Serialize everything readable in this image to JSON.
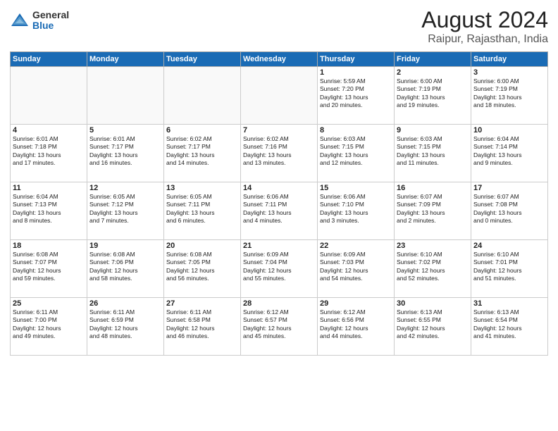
{
  "header": {
    "logo_general": "General",
    "logo_blue": "Blue",
    "month_year": "August 2024",
    "location": "Raipur, Rajasthan, India"
  },
  "columns": [
    "Sunday",
    "Monday",
    "Tuesday",
    "Wednesday",
    "Thursday",
    "Friday",
    "Saturday"
  ],
  "weeks": [
    [
      {
        "day": "",
        "info": ""
      },
      {
        "day": "",
        "info": ""
      },
      {
        "day": "",
        "info": ""
      },
      {
        "day": "",
        "info": ""
      },
      {
        "day": "1",
        "info": "Sunrise: 5:59 AM\nSunset: 7:20 PM\nDaylight: 13 hours\nand 20 minutes."
      },
      {
        "day": "2",
        "info": "Sunrise: 6:00 AM\nSunset: 7:19 PM\nDaylight: 13 hours\nand 19 minutes."
      },
      {
        "day": "3",
        "info": "Sunrise: 6:00 AM\nSunset: 7:19 PM\nDaylight: 13 hours\nand 18 minutes."
      }
    ],
    [
      {
        "day": "4",
        "info": "Sunrise: 6:01 AM\nSunset: 7:18 PM\nDaylight: 13 hours\nand 17 minutes."
      },
      {
        "day": "5",
        "info": "Sunrise: 6:01 AM\nSunset: 7:17 PM\nDaylight: 13 hours\nand 16 minutes."
      },
      {
        "day": "6",
        "info": "Sunrise: 6:02 AM\nSunset: 7:17 PM\nDaylight: 13 hours\nand 14 minutes."
      },
      {
        "day": "7",
        "info": "Sunrise: 6:02 AM\nSunset: 7:16 PM\nDaylight: 13 hours\nand 13 minutes."
      },
      {
        "day": "8",
        "info": "Sunrise: 6:03 AM\nSunset: 7:15 PM\nDaylight: 13 hours\nand 12 minutes."
      },
      {
        "day": "9",
        "info": "Sunrise: 6:03 AM\nSunset: 7:15 PM\nDaylight: 13 hours\nand 11 minutes."
      },
      {
        "day": "10",
        "info": "Sunrise: 6:04 AM\nSunset: 7:14 PM\nDaylight: 13 hours\nand 9 minutes."
      }
    ],
    [
      {
        "day": "11",
        "info": "Sunrise: 6:04 AM\nSunset: 7:13 PM\nDaylight: 13 hours\nand 8 minutes."
      },
      {
        "day": "12",
        "info": "Sunrise: 6:05 AM\nSunset: 7:12 PM\nDaylight: 13 hours\nand 7 minutes."
      },
      {
        "day": "13",
        "info": "Sunrise: 6:05 AM\nSunset: 7:11 PM\nDaylight: 13 hours\nand 6 minutes."
      },
      {
        "day": "14",
        "info": "Sunrise: 6:06 AM\nSunset: 7:11 PM\nDaylight: 13 hours\nand 4 minutes."
      },
      {
        "day": "15",
        "info": "Sunrise: 6:06 AM\nSunset: 7:10 PM\nDaylight: 13 hours\nand 3 minutes."
      },
      {
        "day": "16",
        "info": "Sunrise: 6:07 AM\nSunset: 7:09 PM\nDaylight: 13 hours\nand 2 minutes."
      },
      {
        "day": "17",
        "info": "Sunrise: 6:07 AM\nSunset: 7:08 PM\nDaylight: 13 hours\nand 0 minutes."
      }
    ],
    [
      {
        "day": "18",
        "info": "Sunrise: 6:08 AM\nSunset: 7:07 PM\nDaylight: 12 hours\nand 59 minutes."
      },
      {
        "day": "19",
        "info": "Sunrise: 6:08 AM\nSunset: 7:06 PM\nDaylight: 12 hours\nand 58 minutes."
      },
      {
        "day": "20",
        "info": "Sunrise: 6:08 AM\nSunset: 7:05 PM\nDaylight: 12 hours\nand 56 minutes."
      },
      {
        "day": "21",
        "info": "Sunrise: 6:09 AM\nSunset: 7:04 PM\nDaylight: 12 hours\nand 55 minutes."
      },
      {
        "day": "22",
        "info": "Sunrise: 6:09 AM\nSunset: 7:03 PM\nDaylight: 12 hours\nand 54 minutes."
      },
      {
        "day": "23",
        "info": "Sunrise: 6:10 AM\nSunset: 7:02 PM\nDaylight: 12 hours\nand 52 minutes."
      },
      {
        "day": "24",
        "info": "Sunrise: 6:10 AM\nSunset: 7:01 PM\nDaylight: 12 hours\nand 51 minutes."
      }
    ],
    [
      {
        "day": "25",
        "info": "Sunrise: 6:11 AM\nSunset: 7:00 PM\nDaylight: 12 hours\nand 49 minutes."
      },
      {
        "day": "26",
        "info": "Sunrise: 6:11 AM\nSunset: 6:59 PM\nDaylight: 12 hours\nand 48 minutes."
      },
      {
        "day": "27",
        "info": "Sunrise: 6:11 AM\nSunset: 6:58 PM\nDaylight: 12 hours\nand 46 minutes."
      },
      {
        "day": "28",
        "info": "Sunrise: 6:12 AM\nSunset: 6:57 PM\nDaylight: 12 hours\nand 45 minutes."
      },
      {
        "day": "29",
        "info": "Sunrise: 6:12 AM\nSunset: 6:56 PM\nDaylight: 12 hours\nand 44 minutes."
      },
      {
        "day": "30",
        "info": "Sunrise: 6:13 AM\nSunset: 6:55 PM\nDaylight: 12 hours\nand 42 minutes."
      },
      {
        "day": "31",
        "info": "Sunrise: 6:13 AM\nSunset: 6:54 PM\nDaylight: 12 hours\nand 41 minutes."
      }
    ]
  ]
}
